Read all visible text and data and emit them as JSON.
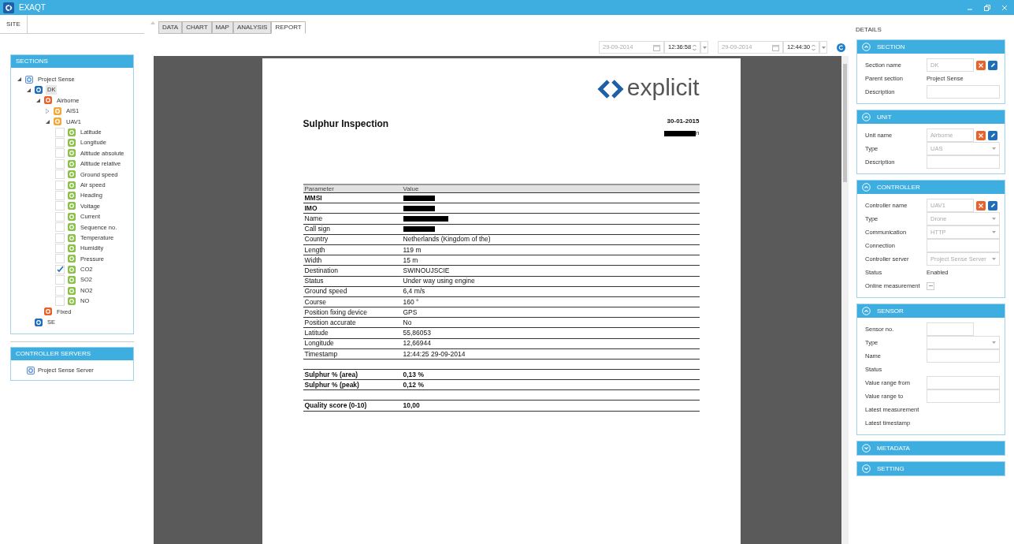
{
  "window": {
    "title": "EXAQT"
  },
  "left_tabs": [
    {
      "label": "SITE",
      "selected": true
    }
  ],
  "sections": {
    "title": "SECTIONS",
    "tree": [
      {
        "label": "Project Sense",
        "kind": "project",
        "expanded": true,
        "children": [
          {
            "label": "DK",
            "kind": "section",
            "expanded": true,
            "selected": true,
            "children": [
              {
                "label": "Airborne",
                "kind": "unit",
                "expanded": true,
                "children": [
                  {
                    "label": "AIS1",
                    "kind": "controller",
                    "expanded": false
                  },
                  {
                    "label": "UAV1",
                    "kind": "controller",
                    "expanded": true,
                    "children": [
                      {
                        "label": "Latitude",
                        "kind": "sensor",
                        "checked": false
                      },
                      {
                        "label": "Longitude",
                        "kind": "sensor",
                        "checked": false
                      },
                      {
                        "label": "Altitude absolute",
                        "kind": "sensor",
                        "checked": false
                      },
                      {
                        "label": "Altitude relative",
                        "kind": "sensor",
                        "checked": false
                      },
                      {
                        "label": "Ground speed",
                        "kind": "sensor",
                        "checked": false
                      },
                      {
                        "label": "Air speed",
                        "kind": "sensor",
                        "checked": false
                      },
                      {
                        "label": "Heading",
                        "kind": "sensor",
                        "checked": false
                      },
                      {
                        "label": "Voltage",
                        "kind": "sensor",
                        "checked": false
                      },
                      {
                        "label": "Current",
                        "kind": "sensor",
                        "checked": false
                      },
                      {
                        "label": "Sequence no.",
                        "kind": "sensor",
                        "checked": false
                      },
                      {
                        "label": "Temperature",
                        "kind": "sensor",
                        "checked": false
                      },
                      {
                        "label": "Humidity",
                        "kind": "sensor",
                        "checked": false
                      },
                      {
                        "label": "Pressure",
                        "kind": "sensor",
                        "checked": false
                      },
                      {
                        "label": "CO2",
                        "kind": "sensor",
                        "checked": true
                      },
                      {
                        "label": "SO2",
                        "kind": "sensor",
                        "checked": false
                      },
                      {
                        "label": "NO2",
                        "kind": "sensor",
                        "checked": false
                      },
                      {
                        "label": "NO",
                        "kind": "sensor",
                        "checked": false
                      }
                    ]
                  }
                ]
              },
              {
                "label": "Fixed",
                "kind": "unit"
              }
            ]
          },
          {
            "label": "SE",
            "kind": "section"
          }
        ]
      }
    ]
  },
  "controller_servers": {
    "title": "CONTROLLER SERVERS",
    "items": [
      {
        "label": "Project Sense Server"
      }
    ]
  },
  "tabs": [
    {
      "label": "DATA",
      "selected": false
    },
    {
      "label": "CHART",
      "selected": false
    },
    {
      "label": "MAP",
      "selected": false
    },
    {
      "label": "ANALYSIS",
      "selected": false
    },
    {
      "label": "REPORT",
      "selected": true
    }
  ],
  "range": {
    "from_date": "29-09-2014",
    "from_time": "12:36:58",
    "to_date": "29-09-2014",
    "to_time": "12:44:30"
  },
  "report": {
    "logo_text": "explicit",
    "title": "Sulphur Inspection",
    "date": "30-01-2015",
    "author_tail": "n",
    "columns": [
      "Parameter",
      "Value"
    ],
    "groups": [
      [
        {
          "parameter": "MMSI",
          "bold": true,
          "redacted": true
        },
        {
          "parameter": "IMO",
          "bold": true,
          "redacted": true
        },
        {
          "parameter": "Name",
          "bold": false,
          "redacted": true
        },
        {
          "parameter": "Call sign",
          "bold": false,
          "redacted": true
        },
        {
          "parameter": "Country",
          "bold": false,
          "value": "Netherlands (Kingdom of the)"
        },
        {
          "parameter": "Length",
          "bold": false,
          "value": "119 m"
        },
        {
          "parameter": "Width",
          "bold": false,
          "value": "15 m"
        },
        {
          "parameter": "Destination",
          "bold": false,
          "value": "SWINOUJSCIE"
        },
        {
          "parameter": "Status",
          "bold": false,
          "value": "Under way using engine"
        },
        {
          "parameter": "Ground speed",
          "bold": false,
          "value": "6,4 m/s"
        },
        {
          "parameter": "Course",
          "bold": false,
          "value": "160 °"
        },
        {
          "parameter": "Position fixing device",
          "bold": false,
          "value": "GPS"
        },
        {
          "parameter": "Position accurate",
          "bold": false,
          "value": "No"
        },
        {
          "parameter": "Latitude",
          "bold": false,
          "value": "55,86053"
        },
        {
          "parameter": "Longitude",
          "bold": false,
          "value": "12,66944"
        },
        {
          "parameter": "Timestamp",
          "bold": false,
          "value": "12:44:25 29-09-2014"
        }
      ],
      [
        {
          "parameter": "Sulphur % (area)",
          "bold": true,
          "value": "0,13 %"
        },
        {
          "parameter": "Sulphur % (peak)",
          "bold": true,
          "value": "0,12 %"
        }
      ],
      [
        {
          "parameter": "Quality score (0-10)",
          "bold": true,
          "value": "10,00"
        }
      ]
    ]
  },
  "details": {
    "title": "DETAILS",
    "panels": [
      {
        "title": "SECTION",
        "expanded": true,
        "fields": [
          {
            "label": "Section name",
            "kind": "text",
            "value": "DK",
            "disabled": true,
            "actions": true
          },
          {
            "label": "Parent section",
            "kind": "static",
            "value": "Project Sense"
          },
          {
            "label": "Description",
            "kind": "text"
          }
        ]
      },
      {
        "title": "UNIT",
        "expanded": true,
        "fields": [
          {
            "label": "Unit name",
            "kind": "text",
            "value": "Airborne",
            "disabled": true,
            "actions": true
          },
          {
            "label": "Type",
            "kind": "select",
            "value": "UAS",
            "disabled": true
          },
          {
            "label": "Description",
            "kind": "text"
          }
        ]
      },
      {
        "title": "CONTROLLER",
        "expanded": true,
        "fields": [
          {
            "label": "Controller name",
            "kind": "text",
            "value": "UAV1",
            "disabled": true,
            "actions": true
          },
          {
            "label": "Type",
            "kind": "select",
            "value": "Drone",
            "disabled": true
          },
          {
            "label": "Communication",
            "kind": "select",
            "value": "HTTP",
            "disabled": true
          },
          {
            "label": "Connection",
            "kind": "text"
          },
          {
            "label": "Controller server",
            "kind": "select",
            "value": "Project Sense Server",
            "disabled": true
          },
          {
            "label": "Status",
            "kind": "static",
            "value": "Enabled"
          },
          {
            "label": "Online measurement",
            "kind": "checkbox",
            "indeterminate": true
          }
        ]
      },
      {
        "title": "SENSOR",
        "expanded": true,
        "fields": [
          {
            "label": "Sensor no.",
            "kind": "short"
          },
          {
            "label": "Type",
            "kind": "select"
          },
          {
            "label": "Name",
            "kind": "text"
          },
          {
            "label": "Status",
            "kind": "static"
          },
          {
            "label": "Value range from",
            "kind": "text"
          },
          {
            "label": "Value range to",
            "kind": "text"
          },
          {
            "label": "Latest measurement",
            "kind": "static"
          },
          {
            "label": "Latest timestamp",
            "kind": "static"
          }
        ]
      },
      {
        "title": "METADATA",
        "expanded": false
      },
      {
        "title": "SETTING",
        "expanded": false
      }
    ]
  }
}
